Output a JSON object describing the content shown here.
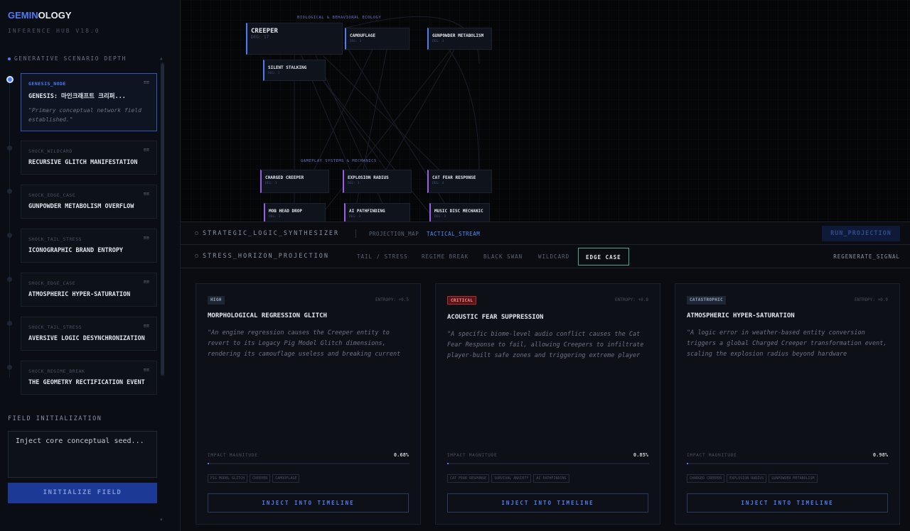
{
  "brand": {
    "prefix": "GEMIN",
    "suffix": "OLOGY",
    "version": "INFERENCE HUB V18.0"
  },
  "sidebar": {
    "depth_label": "GENERATIVE SCENARIO DEPTH",
    "cards": [
      {
        "tag": "GENESIS_NODE",
        "title": "GENESIS: 마인크래프트 크리퍼...",
        "desc": "\"Primary conceptual network field established.\"",
        "menu": "≡≡"
      },
      {
        "tag": "SHOCK_WILDCARD",
        "title": "RECURSIVE GLITCH MANIFESTATION",
        "menu": "≡≡"
      },
      {
        "tag": "SHOCK_EDGE_CASE",
        "title": "GUNPOWDER METABOLISM OVERFLOW",
        "menu": "≡≡"
      },
      {
        "tag": "SHOCK_TAIL_STRESS",
        "title": "ICONOGRAPHIC BRAND ENTROPY",
        "menu": "≡≡"
      },
      {
        "tag": "SHOCK_EDGE_CASE",
        "title": "ATMOSPHERIC HYPER-SATURATION",
        "menu": "≡≡"
      },
      {
        "tag": "SHOCK_TAIL_STRESS",
        "title": "AVERSIVE LOGIC DESYNCHRONIZATION",
        "menu": "≡≡"
      },
      {
        "tag": "SHOCK_REGIME_BREAK",
        "title": "THE GEOMETRY RECTIFICATION EVENT",
        "menu": "≡≡"
      }
    ],
    "field_label": "FIELD INITIALIZATION",
    "seed_placeholder": "Inject core conceptual seed...",
    "init_button": "INITIALIZE FIELD"
  },
  "graph": {
    "cluster1": "BIOLOGICAL & BEHAVIORAL ECOLOGY",
    "cluster2": "GAMEPLAY SYSTEMS & MECHANICS",
    "nodes": [
      {
        "name": "CREEPER",
        "sub": "DEG: 17"
      },
      {
        "name": "CAMOUFLAGE",
        "sub": "DEG: 3"
      },
      {
        "name": "GUNPOWDER METABOLISM",
        "sub": "DEG: 3"
      },
      {
        "name": "SILENT STALKING",
        "sub": "DEG: 3"
      },
      {
        "name": "CHARGED CREEPER",
        "sub": "DEG: 3"
      },
      {
        "name": "EXPLOSION RADIUS",
        "sub": "DEG: 3"
      },
      {
        "name": "CAT FEAR RESPONSE",
        "sub": "DEG: 4"
      },
      {
        "name": "MOB HEAD DROP",
        "sub": "DEG: 3"
      },
      {
        "name": "AI PATHFINDING",
        "sub": "DEG: 3"
      },
      {
        "name": "MUSIC DISC MECHANIC",
        "sub": "DEG: 3"
      }
    ]
  },
  "synth": {
    "title": "STRATEGIC_LOGIC_SYNTHESIZER",
    "view1": "PROJECTION_MAP",
    "view2": "TACTICAL_STREAM",
    "run": "RUN_PROJECTION"
  },
  "stress": {
    "title": "STRESS_HORIZON_PROJECTION",
    "filters": [
      "TAIL / STRESS",
      "REGIME BREAK",
      "BLACK SWAN",
      "WILDCARD",
      "EDGE CASE"
    ],
    "regen": "REGENERATE_SIGNAL"
  },
  "scenarios": [
    {
      "badge": "HIGH",
      "entropy": "ENTROPY: +0.5",
      "title": "MORPHOLOGICAL REGRESSION GLITCH",
      "desc": "\"An engine regression causes the Creeper entity to revert to its Legacy Pig Model Glitch dimensions, rendering its camouflage useless and breaking current",
      "impact_label": "IMPACT MAGNITUDE",
      "impact": "0.68%",
      "chips": [
        "PIG MODEL GLITCH",
        "CREEPER",
        "CAMOUFLAGE"
      ],
      "inject": "INJECT INTO TIMELINE"
    },
    {
      "badge": "CRITICAL",
      "entropy": "ENTROPY: +0.8",
      "title": "ACOUSTIC FEAR SUPPRESSION",
      "desc": "\"A specific biome-level audio conflict causes the Cat Fear Response to fail, allowing Creepers to infiltrate player-built safe zones and triggering extreme player",
      "impact_label": "IMPACT MAGNITUDE",
      "impact": "0.85%",
      "chips": [
        "CAT FEAR RESPONSE",
        "SURVIVAL ANXIETY",
        "AI PATHFINDING"
      ],
      "inject": "INJECT INTO TIMELINE"
    },
    {
      "badge": "CATASTROPHIC",
      "entropy": "ENTROPY: +0.9",
      "title": "ATMOSPHERIC HYPER-SATURATION",
      "desc": "\"A logic error in weather-based entity conversion triggers a global Charged Creeper transformation event, scaling the explosion radius beyond hardware",
      "impact_label": "IMPACT MAGNITUDE",
      "impact": "0.98%",
      "chips": [
        "CHARGED CREEPER",
        "EXPLOSION RADIUS",
        "GUNPOWDER METABOLISM"
      ],
      "inject": "INJECT INTO TIMELINE"
    }
  ]
}
